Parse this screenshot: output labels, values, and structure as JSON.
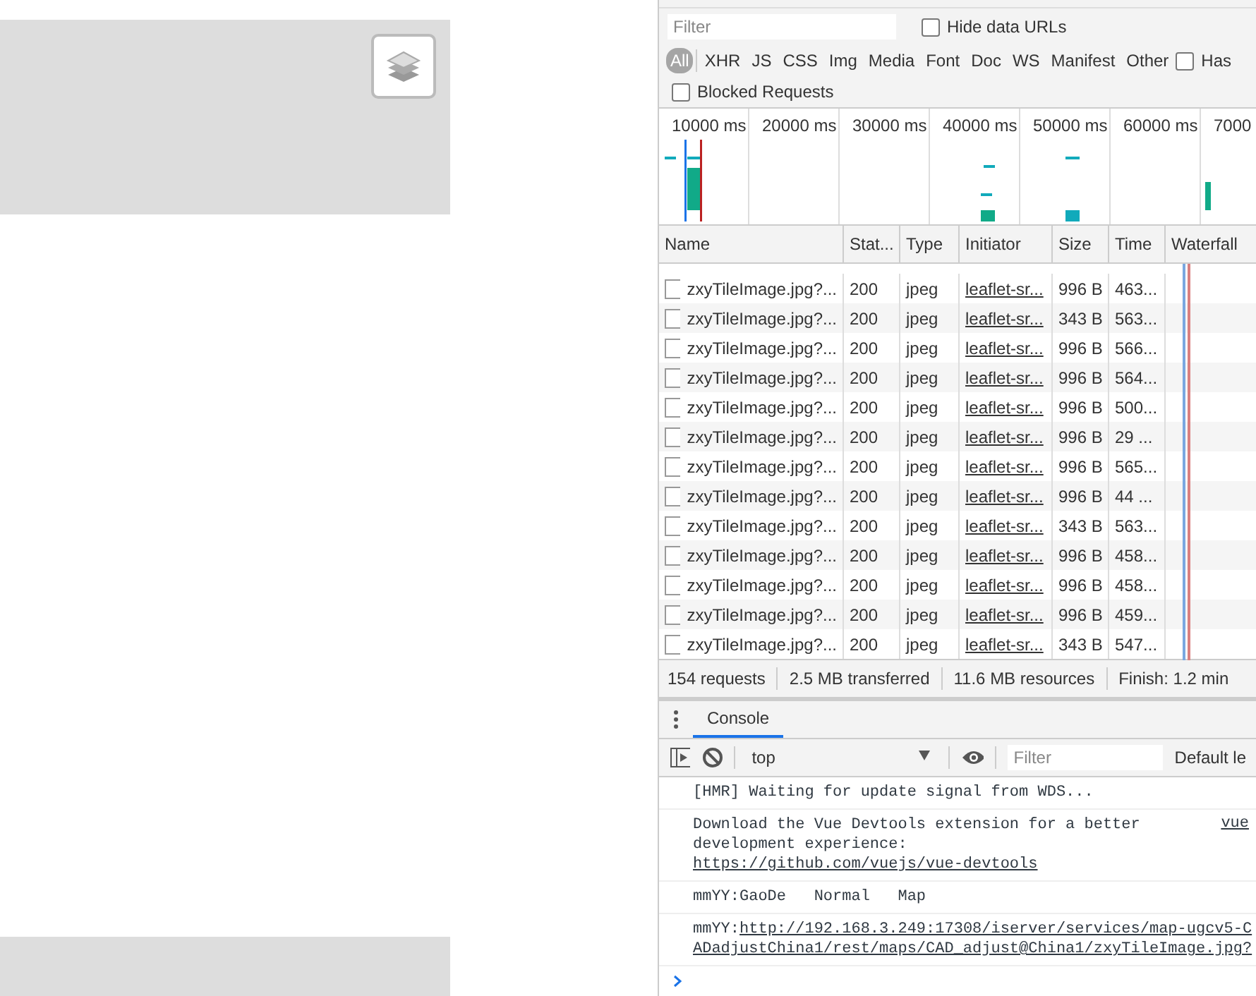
{
  "network": {
    "filter": {
      "placeholder": "Filter"
    },
    "hide_data_urls": {
      "label": "Hide data URLs",
      "checked": false
    },
    "type_filters": [
      {
        "label": "All",
        "selected": true
      },
      {
        "label": "XHR",
        "selected": false
      },
      {
        "label": "JS",
        "selected": false
      },
      {
        "label": "CSS",
        "selected": false
      },
      {
        "label": "Img",
        "selected": false
      },
      {
        "label": "Media",
        "selected": false
      },
      {
        "label": "Font",
        "selected": false
      },
      {
        "label": "Doc",
        "selected": false
      },
      {
        "label": "WS",
        "selected": false
      },
      {
        "label": "Manifest",
        "selected": false
      },
      {
        "label": "Other",
        "selected": false
      }
    ],
    "has_option": {
      "label": "Has",
      "checked": false
    },
    "blocked_requests": {
      "label": "Blocked Requests",
      "checked": false
    },
    "overview_ticks": [
      "10000 ms",
      "20000 ms",
      "30000 ms",
      "40000 ms",
      "50000 ms",
      "60000 ms",
      "7000"
    ],
    "table": {
      "columns": [
        "Name",
        "Stat...",
        "Type",
        "Initiator",
        "Size",
        "Time",
        "Waterfall"
      ],
      "rows": [
        {
          "name": "zxyTileImage.jpg?...",
          "status": "200",
          "type": "jpeg",
          "initiator": "leaflet-sr...",
          "size": "996 B",
          "time": "463..."
        },
        {
          "name": "zxyTileImage.jpg?...",
          "status": "200",
          "type": "jpeg",
          "initiator": "leaflet-sr...",
          "size": "343 B",
          "time": "563..."
        },
        {
          "name": "zxyTileImage.jpg?...",
          "status": "200",
          "type": "jpeg",
          "initiator": "leaflet-sr...",
          "size": "996 B",
          "time": "566..."
        },
        {
          "name": "zxyTileImage.jpg?...",
          "status": "200",
          "type": "jpeg",
          "initiator": "leaflet-sr...",
          "size": "996 B",
          "time": "564..."
        },
        {
          "name": "zxyTileImage.jpg?...",
          "status": "200",
          "type": "jpeg",
          "initiator": "leaflet-sr...",
          "size": "996 B",
          "time": "500..."
        },
        {
          "name": "zxyTileImage.jpg?...",
          "status": "200",
          "type": "jpeg",
          "initiator": "leaflet-sr...",
          "size": "996 B",
          "time": "29 ..."
        },
        {
          "name": "zxyTileImage.jpg?...",
          "status": "200",
          "type": "jpeg",
          "initiator": "leaflet-sr...",
          "size": "996 B",
          "time": "565..."
        },
        {
          "name": "zxyTileImage.jpg?...",
          "status": "200",
          "type": "jpeg",
          "initiator": "leaflet-sr...",
          "size": "996 B",
          "time": "44 ..."
        },
        {
          "name": "zxyTileImage.jpg?...",
          "status": "200",
          "type": "jpeg",
          "initiator": "leaflet-sr...",
          "size": "343 B",
          "time": "563..."
        },
        {
          "name": "zxyTileImage.jpg?...",
          "status": "200",
          "type": "jpeg",
          "initiator": "leaflet-sr...",
          "size": "996 B",
          "time": "458..."
        },
        {
          "name": "zxyTileImage.jpg?...",
          "status": "200",
          "type": "jpeg",
          "initiator": "leaflet-sr...",
          "size": "996 B",
          "time": "458..."
        },
        {
          "name": "zxyTileImage.jpg?...",
          "status": "200",
          "type": "jpeg",
          "initiator": "leaflet-sr...",
          "size": "996 B",
          "time": "459..."
        },
        {
          "name": "zxyTileImage.jpg?...",
          "status": "200",
          "type": "jpeg",
          "initiator": "leaflet-sr...",
          "size": "343 B",
          "time": "547..."
        }
      ]
    },
    "status_bar": [
      "154 requests",
      "2.5 MB transferred",
      "11.6 MB resources",
      "Finish: 1.2 min"
    ]
  },
  "drawer": {
    "tabs": [
      {
        "label": "Console",
        "selected": true
      }
    ],
    "context": "top",
    "filter": {
      "placeholder": "Filter"
    },
    "levels": "Default le",
    "messages": [
      {
        "lines": [
          [
            {
              "kind": "text",
              "text": "[HMR] Waiting for update signal from WDS..."
            }
          ]
        ]
      },
      {
        "source": "vue",
        "lines": [
          [
            {
              "kind": "text",
              "text": "Download the Vue Devtools extension for a better"
            }
          ],
          [
            {
              "kind": "text",
              "text": "development experience:"
            }
          ],
          [
            {
              "kind": "link",
              "text": "https://github.com/vuejs/vue-devtools"
            }
          ]
        ]
      },
      {
        "lines": [
          [
            {
              "kind": "text",
              "text": "mmYY:GaoDe   Normal   Map"
            }
          ]
        ]
      },
      {
        "lines": [
          [
            {
              "kind": "text",
              "text": "mmYY:"
            },
            {
              "kind": "link",
              "text": "http://192.168.3.249:17308/iserver/services/map-ugcv5-C"
            }
          ],
          [
            {
              "kind": "link",
              "text": "ADadjustChina1/rest/maps/CAD_adjust@China1/zxyTileImage.jpg?"
            }
          ]
        ]
      }
    ]
  }
}
